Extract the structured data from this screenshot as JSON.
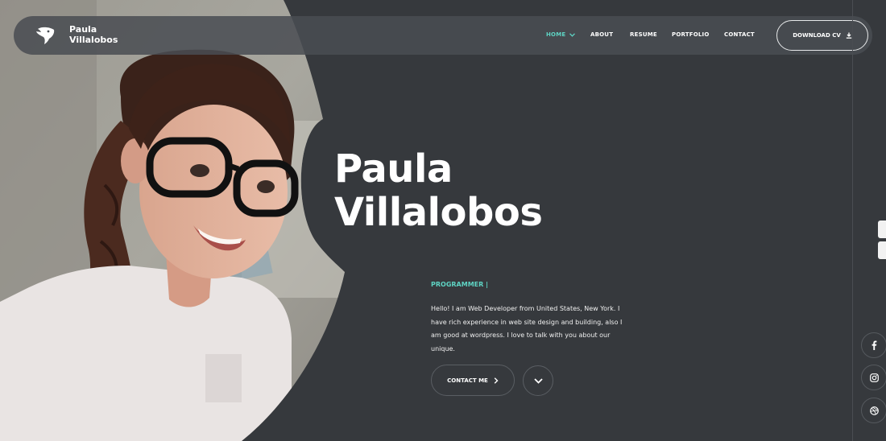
{
  "brand": {
    "first": "Paula",
    "last": "Villalobos"
  },
  "nav": {
    "items": [
      {
        "label": "HOME"
      },
      {
        "label": "ABOUT"
      },
      {
        "label": "RESUME"
      },
      {
        "label": "PORTFOLIO"
      },
      {
        "label": "CONTACT"
      }
    ],
    "download_label": "DOWNLOAD CV"
  },
  "hero": {
    "title_line1": "Paula",
    "title_line2": "Villalobos",
    "role": "PROGRAMMER |",
    "intro_lines": [
      "Hello! I am Web Developer from United States, New York. I",
      "have rich experience in web site design and building, also I",
      "am good at wordpress. I love to talk with you about our",
      "unique."
    ],
    "contact_label": "CONTACT ME"
  },
  "colors": {
    "accent": "#5ed3c3",
    "background": "#36393d",
    "navbar": "#4a4e54"
  },
  "icons": {
    "logo": "bird-logo-icon",
    "home_dropdown": "chevron-down-icon",
    "download": "download-icon",
    "contact_arrow": "chevron-right-icon",
    "scroll": "chevron-down-icon",
    "social": [
      "facebook-icon",
      "instagram-icon",
      "dribbble-icon"
    ]
  }
}
